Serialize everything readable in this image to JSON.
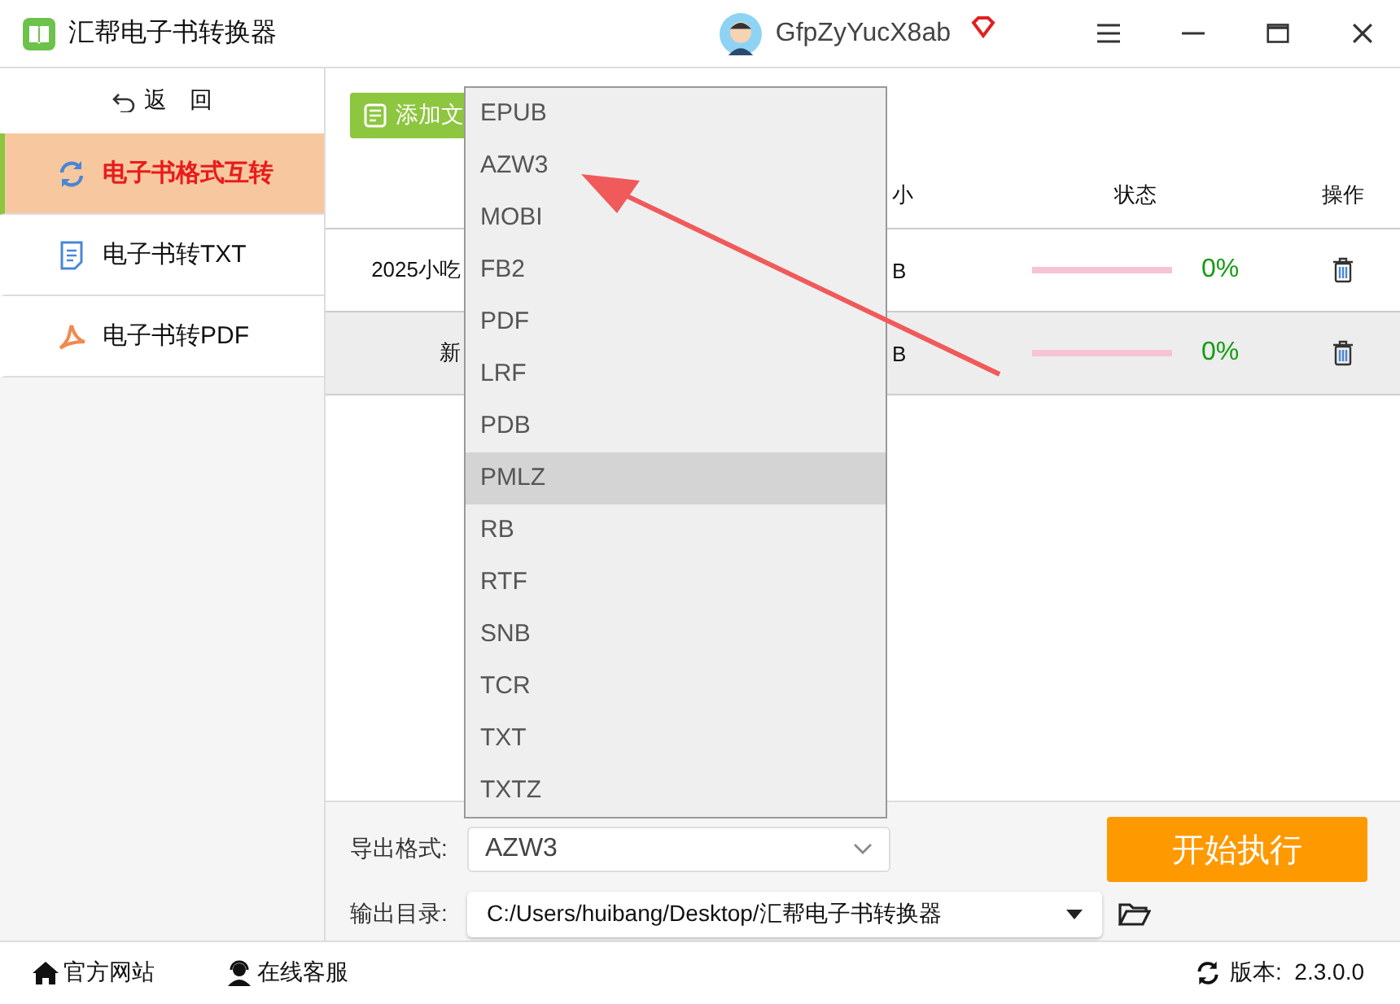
{
  "window": {
    "title": "汇帮电子书转换器",
    "user": "GfpZyYucX8ab"
  },
  "sidebar": {
    "back": "返　回",
    "items": [
      {
        "label": "电子书格式互转",
        "selected": true
      },
      {
        "label": "电子书转TXT",
        "selected": false
      },
      {
        "label": "电子书转PDF",
        "selected": false
      }
    ]
  },
  "toolbar": {
    "add_button": "添加文"
  },
  "table": {
    "columns": [
      "小",
      "状态",
      "操作"
    ],
    "rows": [
      {
        "name": "2025小吃",
        "size": "B",
        "level": 0,
        "percent": "0%",
        "selected": false
      },
      {
        "name": "新",
        "size": "B",
        "level": 0,
        "percent": "0%",
        "selected": true
      }
    ]
  },
  "dropdown": {
    "options": [
      {
        "label": "EPUB",
        "highlighted": false
      },
      {
        "label": "AZW3",
        "highlighted": false
      },
      {
        "label": "MOBI",
        "highlighted": false
      },
      {
        "label": "FB2",
        "highlighted": false
      },
      {
        "label": "PDF",
        "highlighted": false
      },
      {
        "label": "LRF",
        "highlighted": false
      },
      {
        "label": "PDB",
        "highlighted": false
      },
      {
        "label": "PMLZ",
        "highlighted": true
      },
      {
        "label": "RB",
        "highlighted": false
      },
      {
        "label": "RTF",
        "highlighted": false
      },
      {
        "label": "SNB",
        "highlighted": false
      },
      {
        "label": "TCR",
        "highlighted": false
      },
      {
        "label": "TXT",
        "highlighted": false
      },
      {
        "label": "TXTZ",
        "highlighted": false
      }
    ]
  },
  "export_format": {
    "label": "导出格式:",
    "value": "AZW3"
  },
  "output_dir": {
    "label": "输出目录:",
    "value": "C:/Users/huibang/Desktop/汇帮电子书转换器"
  },
  "start_button": "开始执行",
  "footer": {
    "links": [
      {
        "label": "官方网站"
      },
      {
        "label": "在线客服"
      }
    ],
    "version": "版本:  2.3.0.0"
  }
}
